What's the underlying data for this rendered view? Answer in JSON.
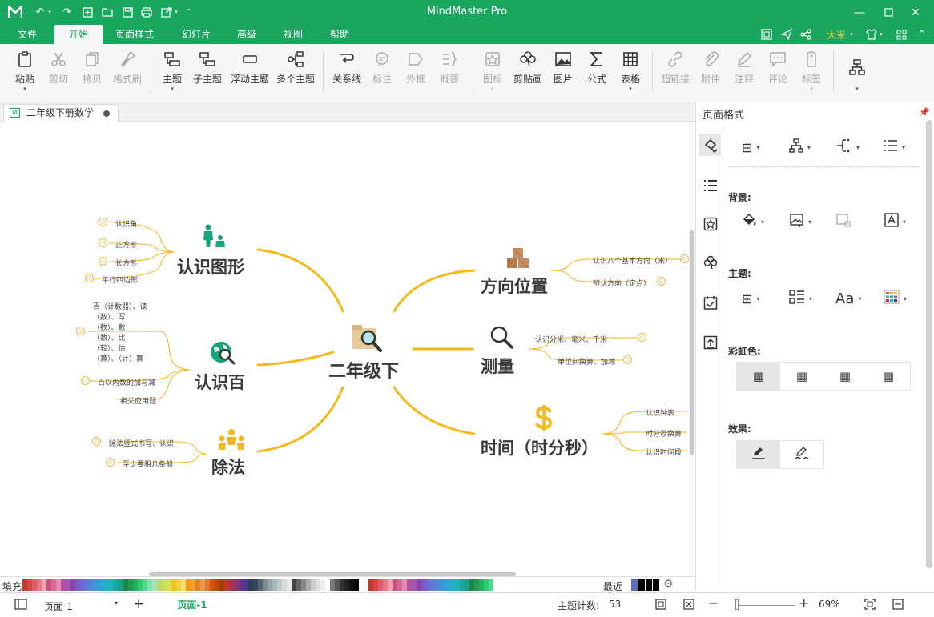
{
  "app": {
    "title": "MindMaster Pro",
    "accent": "#1aa65e"
  },
  "menu": {
    "tabs": [
      "文件",
      "开始",
      "页面样式",
      "幻灯片",
      "高级",
      "视图",
      "帮助"
    ],
    "active_tab": "开始",
    "user": "大米"
  },
  "ribbon": {
    "paste": "粘贴",
    "cut": "剪切",
    "copy": "拷贝",
    "format_painter": "格式刷",
    "topic": "主题",
    "subtopic": "子主题",
    "floating_topic": "浮动主题",
    "multiple_topics": "多个主题",
    "relationship": "关系线",
    "callout": "标注",
    "boundary": "外框",
    "summary": "概要",
    "icon": "图标",
    "clipart": "剪贴画",
    "image": "图片",
    "formula": "公式",
    "table": "表格",
    "hyperlink": "超链接",
    "attachment": "附件",
    "note": "注释",
    "comment": "评论",
    "tag": "标签"
  },
  "document": {
    "tab_name": "二年级下册数学"
  },
  "mindmap": {
    "center": "二年级下",
    "topics": [
      {
        "label": "认识图形",
        "children": [
          "认识角",
          "正方形",
          "长方形",
          "平行四边形"
        ]
      },
      {
        "label": "认识百",
        "children": [
          "百以内数的加与减",
          "相关应用题"
        ],
        "multiline_child": [
          "（计数器）、读",
          "（数）、写",
          "（数）、数",
          "（数）、比",
          "（较）、估",
          "（算）、（计）算"
        ],
        "multiline_prefix": "百"
      },
      {
        "label": "除法",
        "children": [
          "除法竖式书写、认识",
          "至少要租几条船"
        ]
      },
      {
        "label": "方向位置",
        "children": [
          "认识八个基本方向（米）",
          "辨认方向（定点）"
        ]
      },
      {
        "label": "测量",
        "children": [
          "认识分米、毫米、千米",
          "单位间换算、加减"
        ]
      },
      {
        "label": "时间（时分秒）",
        "children": [
          "认识钟表",
          "时分秒换算",
          "认识时间段"
        ]
      }
    ]
  },
  "pane": {
    "title": "页面格式",
    "background_label": "背景:",
    "theme_label": "主题:",
    "rainbow_label": "彩虹色:",
    "effect_label": "效果:"
  },
  "palette": {
    "fill_label": "填充",
    "recent_label": "最近"
  },
  "status": {
    "page_select": "页面-1",
    "page_tab": "页面-1",
    "topic_count_label": "主题计数:",
    "topic_count": "53",
    "zoom": "69%"
  }
}
